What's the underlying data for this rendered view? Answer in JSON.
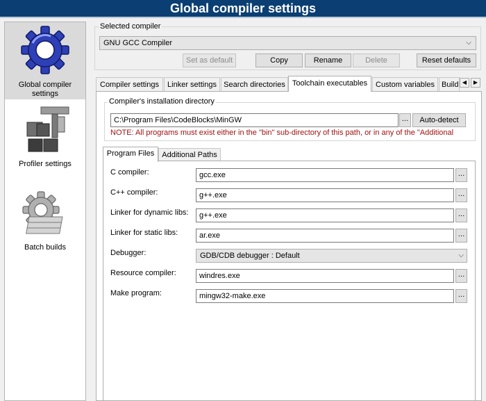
{
  "window": {
    "title": "Global compiler settings"
  },
  "sidebar": {
    "items": [
      {
        "label": "Global compiler settings",
        "icon": "gear-icon",
        "selected": true
      },
      {
        "label": "Profiler settings",
        "icon": "profiler-icon",
        "selected": false
      },
      {
        "label": "Batch builds",
        "icon": "batch-gear-icon",
        "selected": false
      }
    ]
  },
  "compiler": {
    "group_title": "Selected compiler",
    "selected": "GNU GCC Compiler",
    "buttons": {
      "set_default": "Set as default",
      "copy": "Copy",
      "rename": "Rename",
      "delete": "Delete",
      "reset": "Reset defaults"
    }
  },
  "tabs": [
    "Compiler settings",
    "Linker settings",
    "Search directories",
    "Toolchain executables",
    "Custom variables",
    "Build"
  ],
  "toolchain": {
    "install_dir_title": "Compiler's installation directory",
    "install_dir": "C:\\Program Files\\CodeBlocks\\MinGW",
    "browse_label": "...",
    "auto_detect": "Auto-detect",
    "note": "NOTE: All programs must exist either in the \"bin\" sub-directory of this path, or in any of the \"Additional",
    "subtabs": [
      "Program Files",
      "Additional Paths"
    ],
    "programs": [
      {
        "label": "C compiler:",
        "value": "gcc.exe"
      },
      {
        "label": "C++ compiler:",
        "value": "g++.exe"
      },
      {
        "label": "Linker for dynamic libs:",
        "value": "g++.exe"
      },
      {
        "label": "Linker for static libs:",
        "value": "ar.exe"
      }
    ],
    "debugger": {
      "label": "Debugger:",
      "value": "GDB/CDB debugger : Default"
    },
    "resource_compiler": {
      "label": "Resource compiler:",
      "value": "windres.exe"
    },
    "make_program": {
      "label": "Make program:",
      "value": "mingw32-make.exe"
    }
  },
  "colors": {
    "titlebar": "#0b3f73",
    "note": "#a01010",
    "gear_blue": "#2f3fb5"
  }
}
